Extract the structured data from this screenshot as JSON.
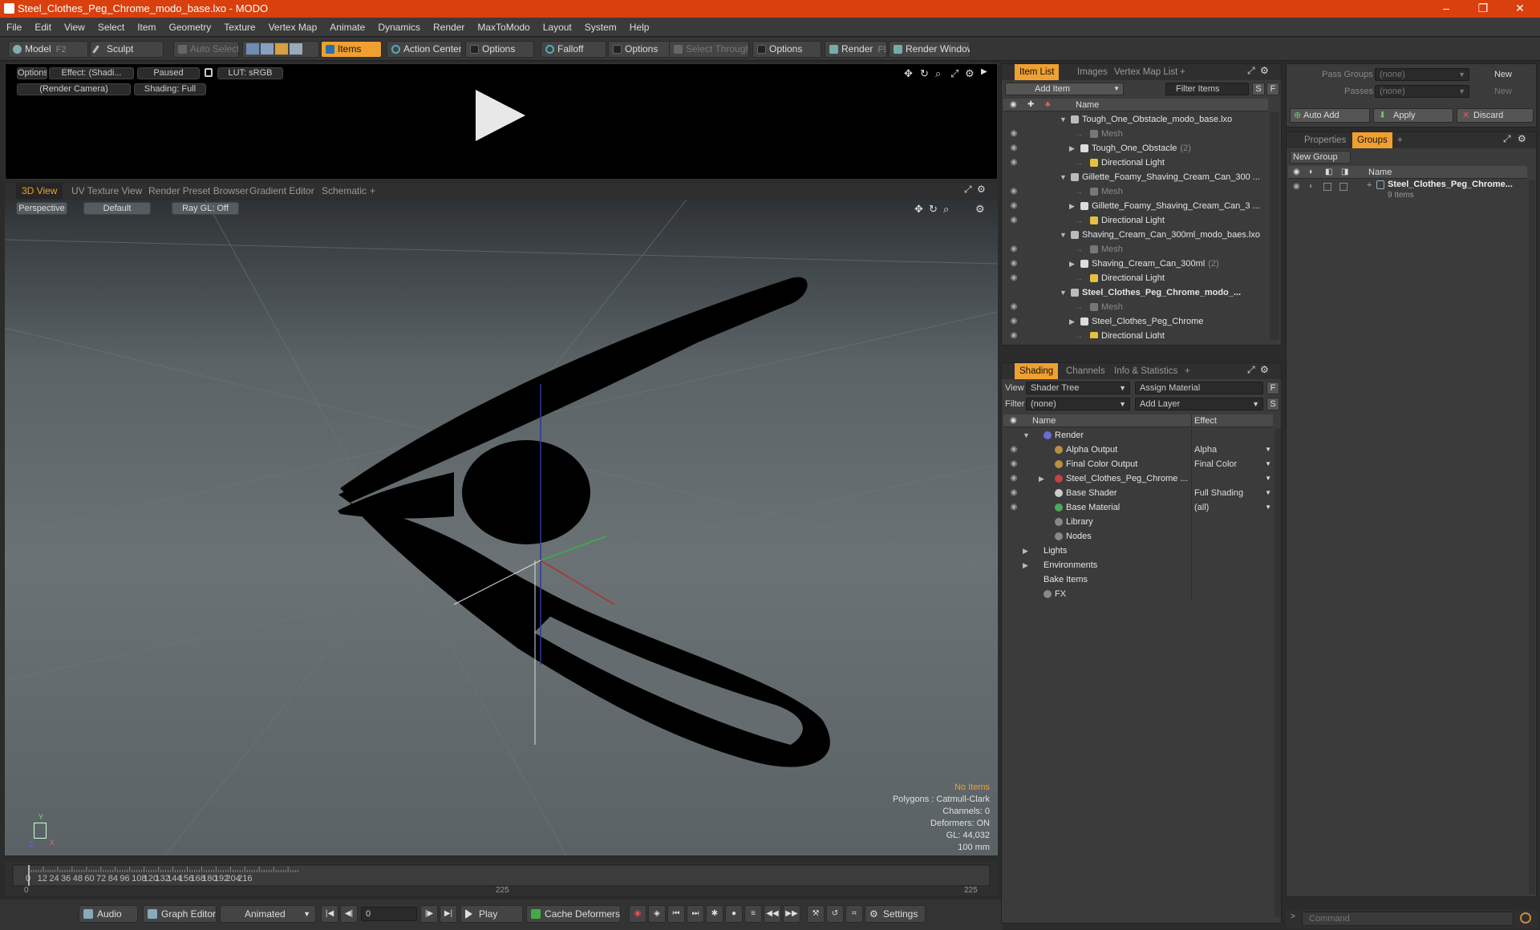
{
  "window": {
    "title": "Steel_Clothes_Peg_Chrome_modo_base.lxo - MODO",
    "minimize": "–",
    "maximize": "❐",
    "close": "✕"
  },
  "menu": [
    "File",
    "Edit",
    "View",
    "Select",
    "Item",
    "Geometry",
    "Texture",
    "Vertex Map",
    "Animate",
    "Dynamics",
    "Render",
    "MaxToModo",
    "Layout",
    "System",
    "Help"
  ],
  "toolbar": {
    "model": "Model",
    "model_key": "F2",
    "sculpt": "Sculpt",
    "auto_select": "Auto Select",
    "items": "Items",
    "action_center": "Action Center",
    "options1": "Options",
    "falloff": "Falloff",
    "options2": "Options",
    "select_through": "Select Through",
    "options3": "Options",
    "render": "Render",
    "render_key": "F9",
    "render_window": "Render Window"
  },
  "render_view": {
    "options": "Options",
    "effect": "Effect: (Shadi...",
    "paused": "Paused",
    "lut": "LUT: sRGB",
    "camera": "(Render Camera)",
    "shading": "Shading: Full"
  },
  "viewport_tabs": [
    "3D View",
    "UV Texture View",
    "Render Preset Browser",
    "Gradient Editor",
    "Schematic",
    "+"
  ],
  "viewport": {
    "perspective": "Perspective",
    "default": "Default",
    "raygl": "Ray GL: Off",
    "stats": {
      "no_items": "No Items",
      "polygons": "Polygons : Catmull-Clark",
      "channels": "Channels: 0",
      "deformers": "Deformers: ON",
      "gl": "GL: 44,032",
      "scale": "100 mm"
    },
    "axis_x": "X",
    "axis_y": "Y",
    "axis_z": "Z"
  },
  "timeline": {
    "ticks": [
      "0",
      "12",
      "24",
      "36",
      "48",
      "60",
      "72",
      "84",
      "96",
      "108",
      "120",
      "132",
      "144",
      "156",
      "168",
      "180",
      "192",
      "204",
      "216"
    ],
    "start": "0",
    "mid": "225",
    "end": "225"
  },
  "bottom": {
    "audio": "Audio",
    "graph_editor": "Graph Editor",
    "animated": "Animated",
    "frame": "0",
    "play": "Play",
    "cache_deformers": "Cache Deformers",
    "settings": "Settings"
  },
  "item_list": {
    "tabs": [
      "Item List",
      "Images",
      "Vertex Map List",
      "+"
    ],
    "add_item": "Add Item",
    "filter_items": "Filter Items",
    "s": "S",
    "f": "F",
    "col_name": "Name",
    "rows": [
      {
        "label": "Tough_One_Obstacle_modo_base.lxo",
        "indent": 0,
        "kind": "scene"
      },
      {
        "label": "Mesh",
        "indent": 2,
        "kind": "mesh"
      },
      {
        "label": "Tough_One_Obstacle",
        "count": "(2)",
        "indent": 1,
        "kind": "group"
      },
      {
        "label": "Directional Light",
        "indent": 2,
        "kind": "light"
      },
      {
        "label": "Gillette_Foamy_Shaving_Cream_Can_300 ...",
        "indent": 0,
        "kind": "scene"
      },
      {
        "label": "Mesh",
        "indent": 2,
        "kind": "mesh"
      },
      {
        "label": "Gillette_Foamy_Shaving_Cream_Can_3 ...",
        "indent": 1,
        "kind": "group"
      },
      {
        "label": "Directional Light",
        "indent": 2,
        "kind": "light"
      },
      {
        "label": "Shaving_Cream_Can_300ml_modo_baes.lxo",
        "indent": 0,
        "kind": "scene"
      },
      {
        "label": "Mesh",
        "indent": 2,
        "kind": "mesh"
      },
      {
        "label": "Shaving_Cream_Can_300ml",
        "count": "(2)",
        "indent": 1,
        "kind": "group"
      },
      {
        "label": "Directional Light",
        "indent": 2,
        "kind": "light"
      },
      {
        "label": "Steel_Clothes_Peg_Chrome_modo_...",
        "indent": 0,
        "kind": "scene",
        "bold": true
      },
      {
        "label": "Mesh",
        "indent": 2,
        "kind": "mesh"
      },
      {
        "label": "Steel_Clothes_Peg_Chrome",
        "indent": 1,
        "kind": "group"
      },
      {
        "label": "Directional Light",
        "indent": 2,
        "kind": "light"
      }
    ]
  },
  "shading": {
    "tabs": [
      "Shading",
      "Channels",
      "Info & Statistics",
      "+"
    ],
    "view_label": "View",
    "view_value": "Shader Tree",
    "assign_material": "Assign Material",
    "filter_label": "Filter",
    "filter_value": "(none)",
    "add_layer": "Add Layer",
    "f": "F",
    "s": "S",
    "col_name": "Name",
    "col_effect": "Effect",
    "rows": [
      {
        "label": "Render",
        "effect": "",
        "indent": 0,
        "eye": false,
        "icon": "#6a6ad8"
      },
      {
        "label": "Alpha Output",
        "effect": "Alpha",
        "indent": 1,
        "eye": true,
        "icon": "#b89040"
      },
      {
        "label": "Final Color Output",
        "effect": "Final Color",
        "indent": 1,
        "eye": true,
        "icon": "#b89040"
      },
      {
        "label": "Steel_Clothes_Peg_Chrome ...",
        "effect": "",
        "indent": 1,
        "eye": true,
        "icon": "#c84040"
      },
      {
        "label": "Base Shader",
        "effect": "Full Shading",
        "indent": 1,
        "eye": true,
        "icon": "#cccccc"
      },
      {
        "label": "Base Material",
        "effect": "(all)",
        "indent": 1,
        "eye": true,
        "icon": "#4caa5a"
      },
      {
        "label": "Library",
        "effect": "",
        "indent": 1,
        "eye": false,
        "icon": "#888888"
      },
      {
        "label": "Nodes",
        "effect": "",
        "indent": 1,
        "eye": false,
        "icon": "#888888"
      },
      {
        "label": "Lights",
        "effect": "",
        "indent": 0,
        "eye": false,
        "icon": ""
      },
      {
        "label": "Environments",
        "effect": "",
        "indent": 0,
        "eye": false,
        "icon": ""
      },
      {
        "label": "Bake Items",
        "effect": "",
        "indent": 0,
        "eye": false,
        "icon": ""
      },
      {
        "label": "FX",
        "effect": "",
        "indent": 0,
        "eye": false,
        "icon": "#888888"
      }
    ]
  },
  "groups": {
    "pass_groups_label": "Pass Groups",
    "pass_groups_value": "(none)",
    "new1": "New",
    "passes_label": "Passes",
    "passes_value": "(none)",
    "new2": "New",
    "auto_add": "Auto Add",
    "apply": "Apply",
    "discard": "Discard",
    "tabs": [
      "Properties",
      "Groups",
      "+"
    ],
    "new_group": "New Group",
    "col_name": "Name",
    "item_name": "Steel_Clothes_Peg_Chrome...",
    "item_sub": "9 Items"
  },
  "command": {
    "placeholder": "Command"
  },
  "colors": {
    "accent": "#f0a030",
    "title": "#d9400d"
  }
}
